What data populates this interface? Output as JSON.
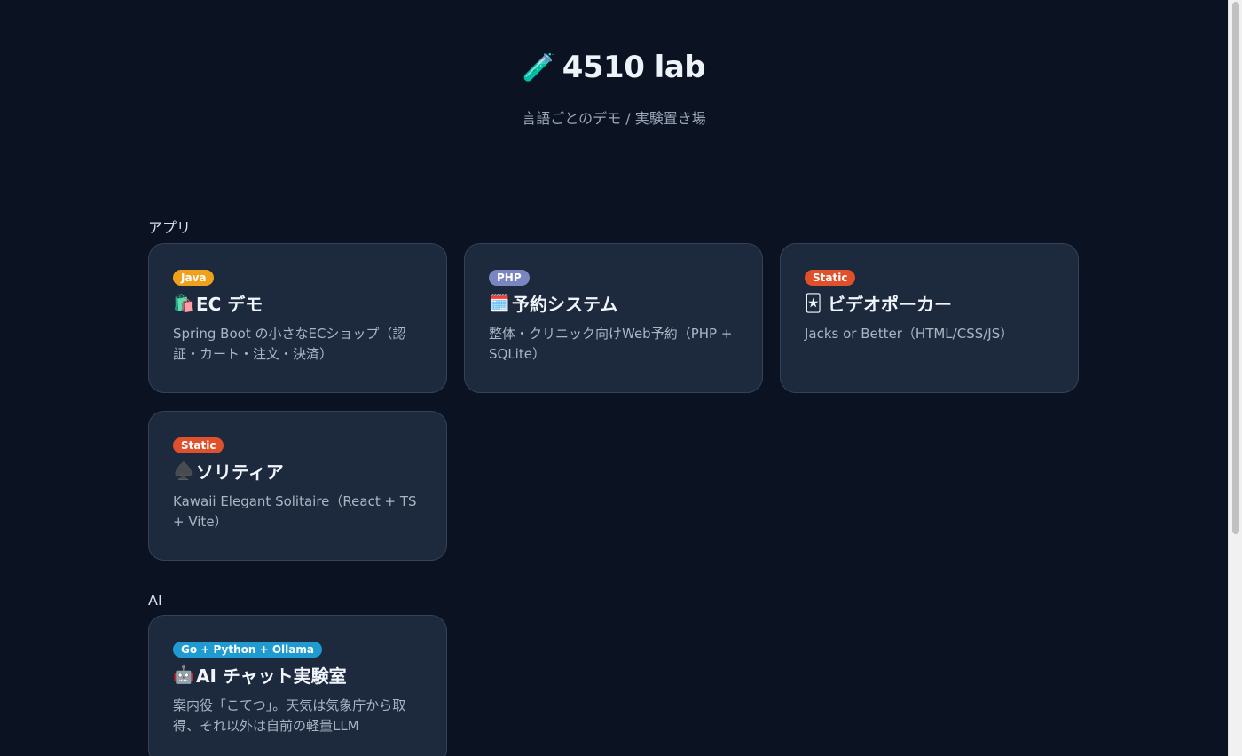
{
  "header": {
    "icon": "test-tube-icon",
    "icon_glyph": "🧪",
    "title": "4510 lab",
    "subtitle": "言語ごとのデモ / 実験置き場"
  },
  "sections": [
    {
      "label": "アプリ",
      "cards": [
        {
          "badge": "Java",
          "badge_color": "#f0a11c",
          "icon": "shopping-bags-icon",
          "icon_glyph": "🛍️",
          "title": "EC デモ",
          "desc": "Spring Boot の小さなECショップ（認証・カート・注文・決済）"
        },
        {
          "badge": "PHP",
          "badge_color": "#7a86bf",
          "icon": "calendar-icon",
          "icon_glyph": "🗓️",
          "title": "予約システム",
          "desc": "整体・クリニック向けWeb予約（PHP + SQLite）"
        },
        {
          "badge": "Static",
          "badge_color": "#e0502b",
          "icon": "playing-card-icon",
          "icon_glyph": "🃏",
          "title": "ビデオポーカー",
          "desc": "Jacks or Better（HTML/CSS/JS）"
        },
        {
          "badge": "Static",
          "badge_color": "#e0502b",
          "icon": "spade-icon",
          "icon_glyph": "♠️",
          "title": "ソリティア",
          "desc": "Kawaii Elegant Solitaire（React + TS + Vite）"
        }
      ]
    },
    {
      "label": "AI",
      "cards": [
        {
          "badge": "Go + Python + Ollama",
          "badge_color": "#1f9bd1",
          "icon": "robot-icon",
          "icon_glyph": "🤖",
          "title": "AI チャット実験室",
          "desc": "案内役「こてつ」。天気は気象庁から取得、それ以外は自前の軽量LLM"
        }
      ]
    }
  ]
}
